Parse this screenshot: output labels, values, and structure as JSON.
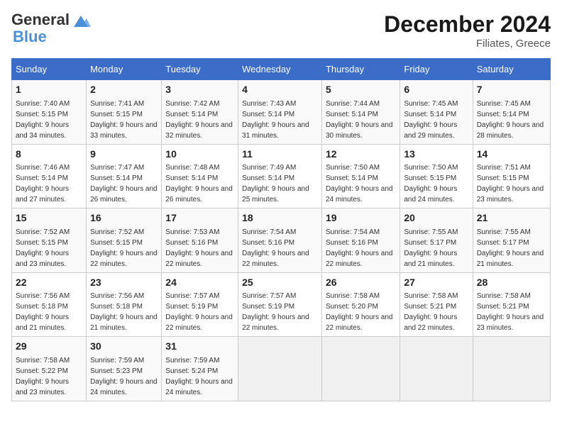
{
  "header": {
    "logo_line1": "General",
    "logo_line2": "Blue",
    "main_title": "December 2024",
    "subtitle": "Filiates, Greece"
  },
  "weekdays": [
    "Sunday",
    "Monday",
    "Tuesday",
    "Wednesday",
    "Thursday",
    "Friday",
    "Saturday"
  ],
  "weeks": [
    [
      {
        "day": "1",
        "rise": "Sunrise: 7:40 AM",
        "set": "Sunset: 5:15 PM",
        "daylight": "Daylight: 9 hours and 34 minutes."
      },
      {
        "day": "2",
        "rise": "Sunrise: 7:41 AM",
        "set": "Sunset: 5:15 PM",
        "daylight": "Daylight: 9 hours and 33 minutes."
      },
      {
        "day": "3",
        "rise": "Sunrise: 7:42 AM",
        "set": "Sunset: 5:14 PM",
        "daylight": "Daylight: 9 hours and 32 minutes."
      },
      {
        "day": "4",
        "rise": "Sunrise: 7:43 AM",
        "set": "Sunset: 5:14 PM",
        "daylight": "Daylight: 9 hours and 31 minutes."
      },
      {
        "day": "5",
        "rise": "Sunrise: 7:44 AM",
        "set": "Sunset: 5:14 PM",
        "daylight": "Daylight: 9 hours and 30 minutes."
      },
      {
        "day": "6",
        "rise": "Sunrise: 7:45 AM",
        "set": "Sunset: 5:14 PM",
        "daylight": "Daylight: 9 hours and 29 minutes."
      },
      {
        "day": "7",
        "rise": "Sunrise: 7:45 AM",
        "set": "Sunset: 5:14 PM",
        "daylight": "Daylight: 9 hours and 28 minutes."
      }
    ],
    [
      {
        "day": "8",
        "rise": "Sunrise: 7:46 AM",
        "set": "Sunset: 5:14 PM",
        "daylight": "Daylight: 9 hours and 27 minutes."
      },
      {
        "day": "9",
        "rise": "Sunrise: 7:47 AM",
        "set": "Sunset: 5:14 PM",
        "daylight": "Daylight: 9 hours and 26 minutes."
      },
      {
        "day": "10",
        "rise": "Sunrise: 7:48 AM",
        "set": "Sunset: 5:14 PM",
        "daylight": "Daylight: 9 hours and 26 minutes."
      },
      {
        "day": "11",
        "rise": "Sunrise: 7:49 AM",
        "set": "Sunset: 5:14 PM",
        "daylight": "Daylight: 9 hours and 25 minutes."
      },
      {
        "day": "12",
        "rise": "Sunrise: 7:50 AM",
        "set": "Sunset: 5:14 PM",
        "daylight": "Daylight: 9 hours and 24 minutes."
      },
      {
        "day": "13",
        "rise": "Sunrise: 7:50 AM",
        "set": "Sunset: 5:15 PM",
        "daylight": "Daylight: 9 hours and 24 minutes."
      },
      {
        "day": "14",
        "rise": "Sunrise: 7:51 AM",
        "set": "Sunset: 5:15 PM",
        "daylight": "Daylight: 9 hours and 23 minutes."
      }
    ],
    [
      {
        "day": "15",
        "rise": "Sunrise: 7:52 AM",
        "set": "Sunset: 5:15 PM",
        "daylight": "Daylight: 9 hours and 23 minutes."
      },
      {
        "day": "16",
        "rise": "Sunrise: 7:52 AM",
        "set": "Sunset: 5:15 PM",
        "daylight": "Daylight: 9 hours and 22 minutes."
      },
      {
        "day": "17",
        "rise": "Sunrise: 7:53 AM",
        "set": "Sunset: 5:16 PM",
        "daylight": "Daylight: 9 hours and 22 minutes."
      },
      {
        "day": "18",
        "rise": "Sunrise: 7:54 AM",
        "set": "Sunset: 5:16 PM",
        "daylight": "Daylight: 9 hours and 22 minutes."
      },
      {
        "day": "19",
        "rise": "Sunrise: 7:54 AM",
        "set": "Sunset: 5:16 PM",
        "daylight": "Daylight: 9 hours and 22 minutes."
      },
      {
        "day": "20",
        "rise": "Sunrise: 7:55 AM",
        "set": "Sunset: 5:17 PM",
        "daylight": "Daylight: 9 hours and 21 minutes."
      },
      {
        "day": "21",
        "rise": "Sunrise: 7:55 AM",
        "set": "Sunset: 5:17 PM",
        "daylight": "Daylight: 9 hours and 21 minutes."
      }
    ],
    [
      {
        "day": "22",
        "rise": "Sunrise: 7:56 AM",
        "set": "Sunset: 5:18 PM",
        "daylight": "Daylight: 9 hours and 21 minutes."
      },
      {
        "day": "23",
        "rise": "Sunrise: 7:56 AM",
        "set": "Sunset: 5:18 PM",
        "daylight": "Daylight: 9 hours and 21 minutes."
      },
      {
        "day": "24",
        "rise": "Sunrise: 7:57 AM",
        "set": "Sunset: 5:19 PM",
        "daylight": "Daylight: 9 hours and 22 minutes."
      },
      {
        "day": "25",
        "rise": "Sunrise: 7:57 AM",
        "set": "Sunset: 5:19 PM",
        "daylight": "Daylight: 9 hours and 22 minutes."
      },
      {
        "day": "26",
        "rise": "Sunrise: 7:58 AM",
        "set": "Sunset: 5:20 PM",
        "daylight": "Daylight: 9 hours and 22 minutes."
      },
      {
        "day": "27",
        "rise": "Sunrise: 7:58 AM",
        "set": "Sunset: 5:21 PM",
        "daylight": "Daylight: 9 hours and 22 minutes."
      },
      {
        "day": "28",
        "rise": "Sunrise: 7:58 AM",
        "set": "Sunset: 5:21 PM",
        "daylight": "Daylight: 9 hours and 23 minutes."
      }
    ],
    [
      {
        "day": "29",
        "rise": "Sunrise: 7:58 AM",
        "set": "Sunset: 5:22 PM",
        "daylight": "Daylight: 9 hours and 23 minutes."
      },
      {
        "day": "30",
        "rise": "Sunrise: 7:59 AM",
        "set": "Sunset: 5:23 PM",
        "daylight": "Daylight: 9 hours and 24 minutes."
      },
      {
        "day": "31",
        "rise": "Sunrise: 7:59 AM",
        "set": "Sunset: 5:24 PM",
        "daylight": "Daylight: 9 hours and 24 minutes."
      },
      null,
      null,
      null,
      null
    ]
  ]
}
